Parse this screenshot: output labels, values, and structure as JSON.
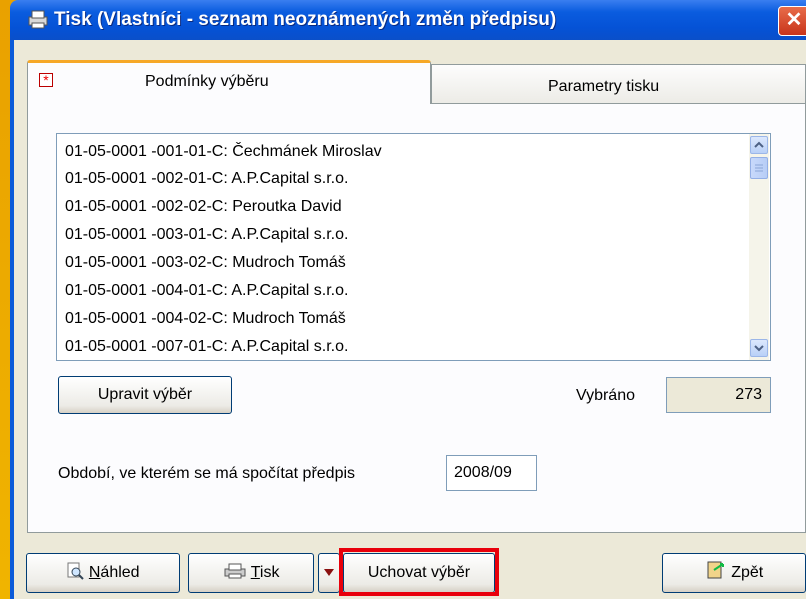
{
  "window": {
    "title": "Tisk (Vlastníci - seznam neoznámených změn předpisu)",
    "close_glyph": "✕"
  },
  "tabs": [
    {
      "label": "Podmínky výběru",
      "active": true,
      "marker": "*"
    },
    {
      "label": "Parametry tisku",
      "active": false
    }
  ],
  "list": {
    "items": [
      "01-05-0001 -001-01-C: Čechmánek Miroslav",
      "01-05-0001 -002-01-C: A.P.Capital s.r.o.",
      "01-05-0001 -002-02-C: Peroutka David",
      "01-05-0001 -003-01-C: A.P.Capital s.r.o.",
      "01-05-0001 -003-02-C: Mudroch Tomáš",
      "01-05-0001 -004-01-C: A.P.Capital s.r.o.",
      "01-05-0001 -004-02-C: Mudroch Tomáš",
      "01-05-0001 -007-01-C: A.P.Capital s.r.o."
    ]
  },
  "edit_selection_label": "Upravit výběr",
  "selected": {
    "label": "Vybráno",
    "value": "273"
  },
  "period": {
    "label": "Období, ve kterém se má spočítat předpis",
    "value": "2008/09"
  },
  "footer": {
    "preview_key": "N",
    "preview_rest": "áhled",
    "print_key": "T",
    "print_rest": "isk",
    "save_selection_label": "Uchovat výběr",
    "back_label": "Zpět"
  },
  "colors": {
    "highlight": "#e8000b",
    "title_bar": "#0552d6",
    "tab_accent": "#f6a827"
  },
  "icons": [
    "printer-icon",
    "close-icon",
    "magnifier-icon",
    "dropdown-arrow-icon",
    "back-door-icon",
    "scroll-up-icon",
    "scroll-down-icon"
  ]
}
